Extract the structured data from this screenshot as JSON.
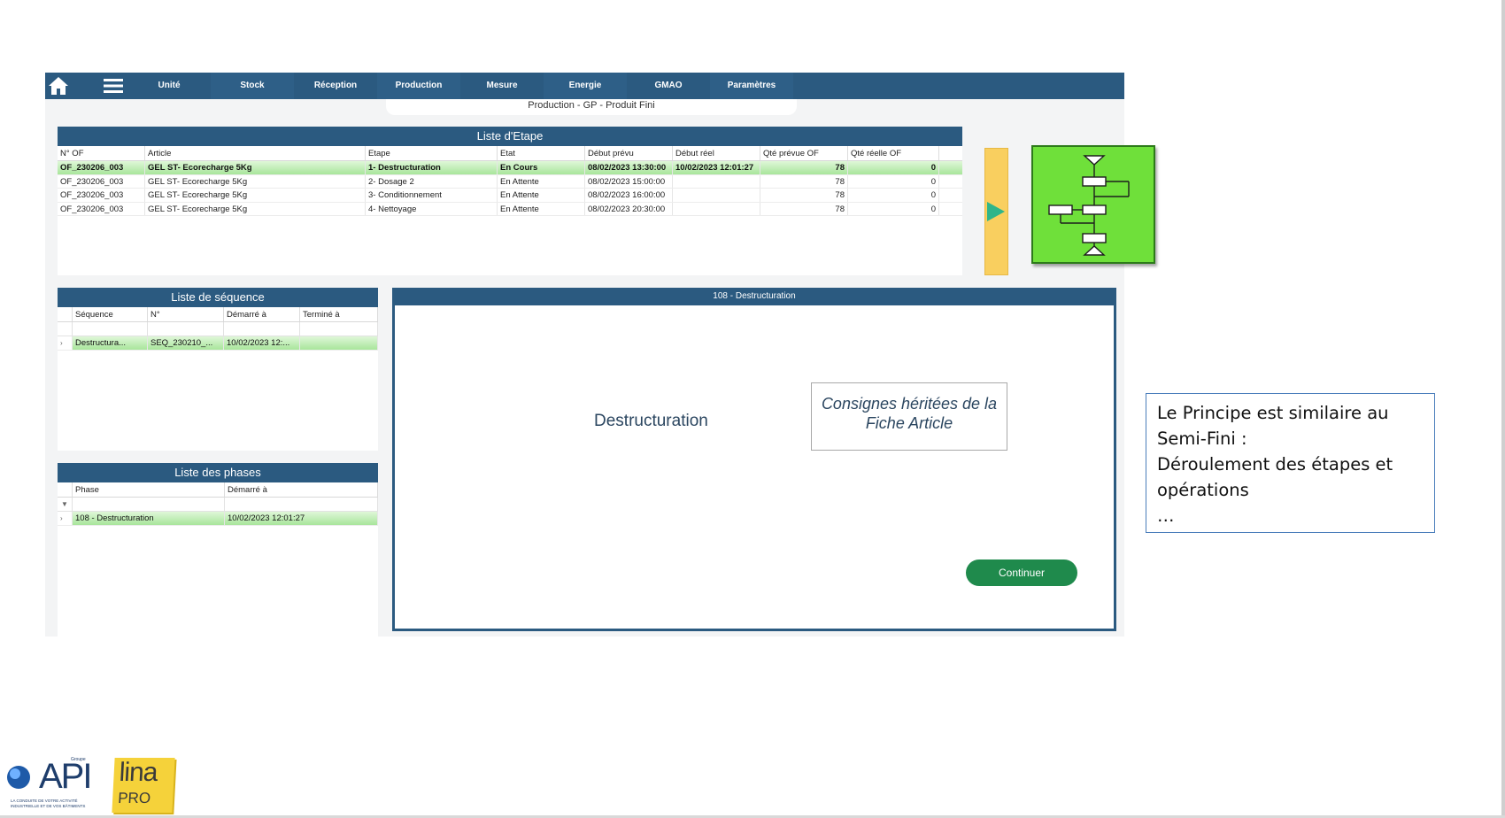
{
  "nav": {
    "items": [
      "Unité",
      "Stock",
      "Réception",
      "Production",
      "Mesure",
      "Energie",
      "GMAO",
      "Paramètres"
    ]
  },
  "page_subtitle": "Production - GP - Produit Fini",
  "etape": {
    "title": "Liste d'Etape",
    "columns": [
      "N° OF",
      "Article",
      "Etape",
      "Etat",
      "Début prévu",
      "Début réel",
      "Qté prévue OF",
      "Qté réelle OF"
    ],
    "rows": [
      [
        "OF_230206_003",
        "GEL ST- Ecorecharge 5Kg",
        "1- Destructuration",
        "En Cours",
        "08/02/2023 13:30:00",
        "10/02/2023 12:01:27",
        "78",
        "0"
      ],
      [
        "OF_230206_003",
        "GEL ST- Ecorecharge 5Kg",
        "2- Dosage 2",
        "En Attente",
        "08/02/2023 15:00:00",
        "",
        "78",
        "0"
      ],
      [
        "OF_230206_003",
        "GEL ST- Ecorecharge 5Kg",
        "3- Conditionnement",
        "En Attente",
        "08/02/2023 16:00:00",
        "",
        "78",
        "0"
      ],
      [
        "OF_230206_003",
        "GEL ST- Ecorecharge 5Kg",
        "4- Nettoyage",
        "En Attente",
        "08/02/2023 20:30:00",
        "",
        "78",
        "0"
      ]
    ]
  },
  "sequence": {
    "title": "Liste de séquence",
    "columns": [
      "Séquence",
      "N°",
      "Démarré à",
      "Terminé à"
    ],
    "rows": [
      [
        "Destructura...",
        "SEQ_230210_...",
        "10/02/2023 12:...",
        ""
      ]
    ]
  },
  "phases": {
    "title": "Liste des phases",
    "columns": [
      "Phase",
      "Démarré à"
    ],
    "rows": [
      [
        "108 - Destructuration",
        "10/02/2023 12:01:27"
      ]
    ]
  },
  "detail": {
    "title": "108 - Destructuration",
    "step_name": "Destructuration",
    "consignes": "Consignes héritées de la Fiche Article",
    "continue_label": "Continuer"
  },
  "info_text": {
    "line1": "Le Principe est similaire au",
    "line2": "Semi-Fini :",
    "line3": "Déroulement des étapes et",
    "line4": "opérations",
    "line5": "…"
  },
  "logos": {
    "api_main": "API",
    "api_group": "Groupe",
    "api_tagline1": "LA CONDUITE DE VOTRE ACTIVITÉ",
    "api_tagline2": "INDUSTRIELLE ET DE VOS BÂTIMENTS",
    "lina_main": "lina",
    "lina_sub": "PRO"
  },
  "colors": {
    "header_blue": "#2b5a80",
    "active_row_green": "#a8e59b",
    "continue_green": "#1f8a4c",
    "scroll_yellow": "#f9cf5f",
    "flow_green": "#6fe03a"
  }
}
